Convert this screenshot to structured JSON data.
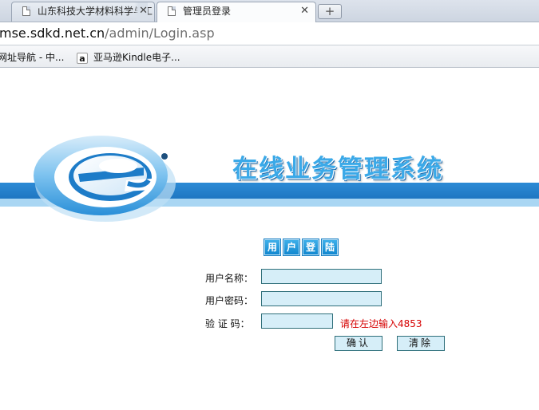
{
  "browser": {
    "tabs": [
      {
        "title": "山东科技大学材料科学与工",
        "close": "✕"
      },
      {
        "title": "管理员登录",
        "close": "✕"
      }
    ],
    "new_tab": "+",
    "url_host": "mse.sdkd.net.cn",
    "url_path": "/admin/Login.asp",
    "bookmarks": [
      {
        "label": "网址导航 - 中..."
      },
      {
        "icon": "amazon-icon",
        "icon_glyph": "a",
        "label": "亚马逊Kindle电子..."
      }
    ]
  },
  "banner": {
    "title": "在线业务管理系统"
  },
  "login": {
    "heading_chars": [
      "用",
      "户",
      "登",
      "陆"
    ],
    "username_label": "用户名称：",
    "password_label": "用户密码：",
    "captcha_label": "验 证 码：",
    "username_value": "",
    "password_value": "",
    "captcha_value": "",
    "captcha_hint": "请在左边输入4853",
    "confirm_button": "确认",
    "clear_button": "清除"
  },
  "colors": {
    "banner_stripe": "#1f76c2",
    "banner_stripe_light": "#a9d6f3",
    "title_blue": "#3ba9e8",
    "hint_red": "#d60000",
    "field_bg": "#d6eef8"
  }
}
